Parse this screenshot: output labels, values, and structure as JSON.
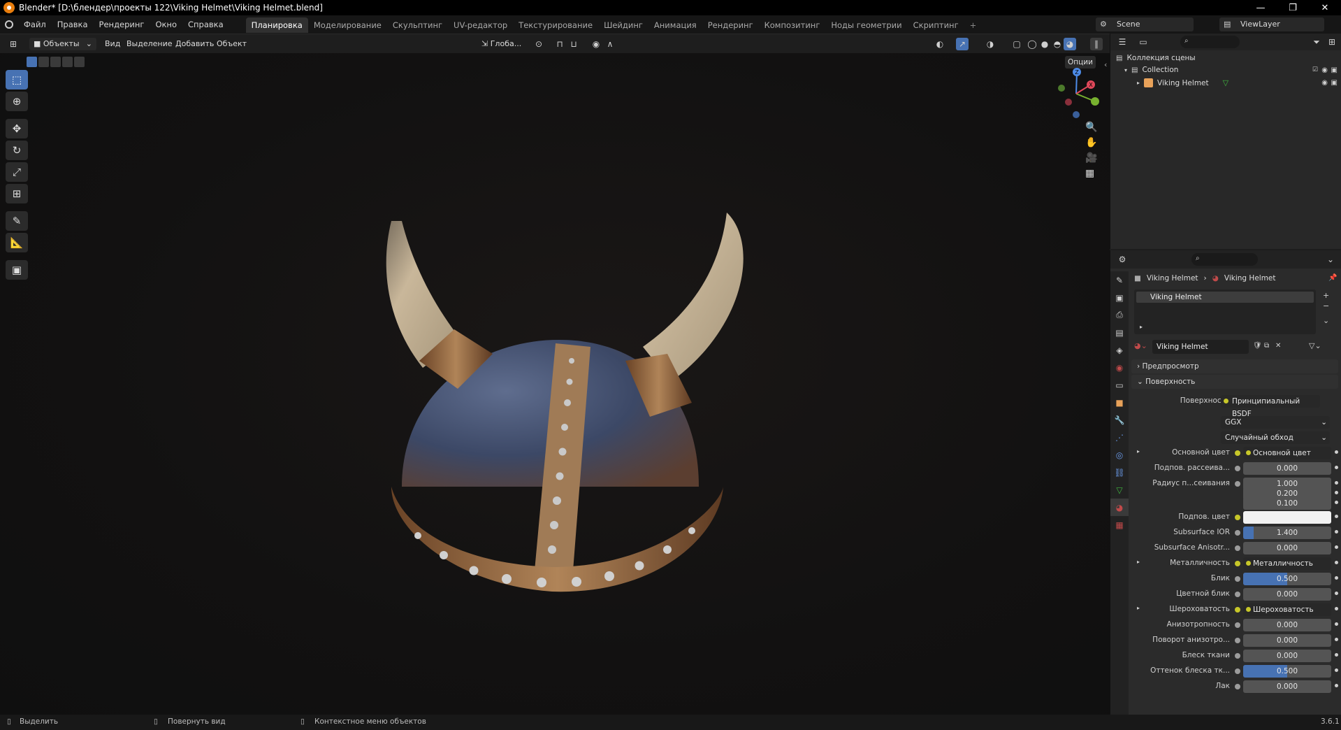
{
  "window": {
    "title": "Blender* [D:\\блендер\\проекты 122\\Viking Helmet\\Viking Helmet.blend]",
    "minimize": "—",
    "maximize": "❐",
    "close": "✕"
  },
  "menu": [
    "Файл",
    "Правка",
    "Рендеринг",
    "Окно",
    "Справка"
  ],
  "workspaces": [
    "Планировка",
    "Моделирование",
    "Скульптинг",
    "UV-редактор",
    "Текстурирование",
    "Шейдинг",
    "Анимация",
    "Рендеринг",
    "Композитинг",
    "Ноды геометрии",
    "Скриптинг"
  ],
  "workspace_add": "+",
  "scene": {
    "label": "Scene",
    "viewlayer": "ViewLayer"
  },
  "viewport_header": {
    "mode": "Объекты",
    "view": "Вид",
    "select": "Выделение",
    "add": "Добавить",
    "object": "Объект",
    "orientation": "Глоба...",
    "options": "Опции"
  },
  "outliner": {
    "scene_collection": "Коллекция сцены",
    "collection": "Collection",
    "object": "Viking Helmet"
  },
  "properties": {
    "breadcrumb_object": "Viking Helmet",
    "breadcrumb_material": "Viking Helmet",
    "slot": "Viking Helmet",
    "material_name": "Viking Helmet",
    "preview": "Предпросмотр",
    "surface_panel": "Поверхность",
    "surface_label": "Поверхность",
    "surface_value": "Принципиальный BSDF",
    "distribution": "GGX",
    "subsurface_method": "Случайный обход",
    "rows": [
      {
        "label": "Основной цвет",
        "type": "node",
        "value": "Основной цвет",
        "arrow": true
      },
      {
        "label": "Подпов. рассеива...",
        "type": "num",
        "value": "0.000",
        "fill": 0
      },
      {
        "label": "Радиус п...сеивания",
        "type": "num",
        "value": "1.000",
        "fill": 0
      },
      {
        "label": "",
        "type": "num",
        "value": "0.200",
        "fill": 0
      },
      {
        "label": "",
        "type": "num",
        "value": "0.100",
        "fill": 0
      },
      {
        "label": "Подпов. цвет",
        "type": "color",
        "value": "#f2f2f2"
      },
      {
        "label": "Subsurface IOR",
        "type": "num",
        "value": "1.400",
        "fill": 0.12
      },
      {
        "label": "Subsurface Anisotr...",
        "type": "num",
        "value": "0.000",
        "fill": 0
      },
      {
        "label": "Металличность",
        "type": "node",
        "value": "Металличность",
        "arrow": true
      },
      {
        "label": "Блик",
        "type": "num",
        "value": "0.500",
        "fill": 0.5
      },
      {
        "label": "Цветной блик",
        "type": "num",
        "value": "0.000",
        "fill": 0
      },
      {
        "label": "Шероховатость",
        "type": "node",
        "value": "Шероховатость",
        "arrow": true
      },
      {
        "label": "Анизотропность",
        "type": "num",
        "value": "0.000",
        "fill": 0
      },
      {
        "label": "Поворот анизотро...",
        "type": "num",
        "value": "0.000",
        "fill": 0
      },
      {
        "label": "Блеск ткани",
        "type": "num",
        "value": "0.000",
        "fill": 0
      },
      {
        "label": "Оттенок блеска тк...",
        "type": "num",
        "value": "0.500",
        "fill": 0.5
      },
      {
        "label": "Лак",
        "type": "num",
        "value": "0.000",
        "fill": 0
      }
    ]
  },
  "statusbar": {
    "select": "Выделить",
    "rotate": "Повернуть вид",
    "context": "Контекстное меню объектов",
    "version": "3.6.1"
  },
  "colors": {
    "accent": "#4772b3",
    "helmet_dome": "#3c4866",
    "horn": "#c9b79a",
    "bronze": "#9a6a3e"
  }
}
